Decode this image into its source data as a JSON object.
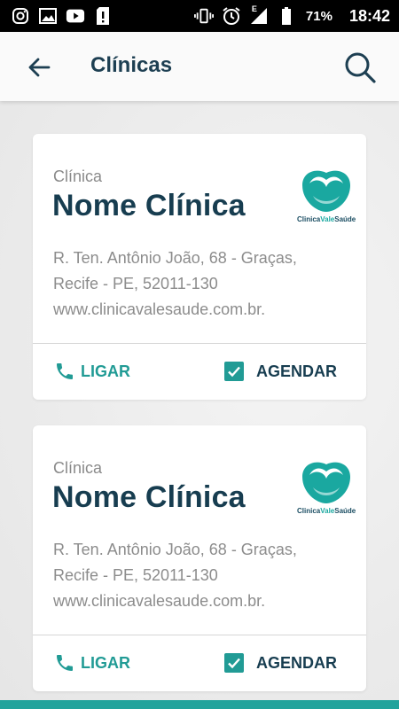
{
  "status_bar": {
    "battery": "71%",
    "time": "18:42",
    "network_label": "E",
    "icons": [
      "instagram-icon",
      "gallery-icon",
      "youtube-icon",
      "sim-alert-icon",
      "vibrate-icon",
      "alarm-icon",
      "signal-icon",
      "battery-icon"
    ]
  },
  "app_bar": {
    "title": "Clínicas",
    "back_icon": "arrow-back-icon",
    "search_icon": "search-icon"
  },
  "clinics": [
    {
      "label": "Clínica",
      "name": "Nome Clínica",
      "address_line1": "R. Ten. Antônio João, 68 - Graças,",
      "address_line2": "Recife - PE, 52011-130",
      "website": "www.clinicavalesaude.com.br.",
      "logo_text_a": "Clinica",
      "logo_text_b": "Vale",
      "logo_text_c": "Saúde",
      "call_label": "LIGAR",
      "book_label": "AGENDAR",
      "book_checked": true
    },
    {
      "label": "Clínica",
      "name": "Nome Clínica",
      "address_line1": "R. Ten. Antônio João, 68 - Graças,",
      "address_line2": "Recife - PE, 52011-130",
      "website": "www.clinicavalesaude.com.br.",
      "logo_text_a": "Clinica",
      "logo_text_b": "Vale",
      "logo_text_c": "Saúde",
      "call_label": "LIGAR",
      "book_label": "AGENDAR",
      "book_checked": true
    }
  ],
  "colors": {
    "primary_dark": "#173d50",
    "accent_teal": "#219b95",
    "muted_text": "#8c8c8c"
  }
}
